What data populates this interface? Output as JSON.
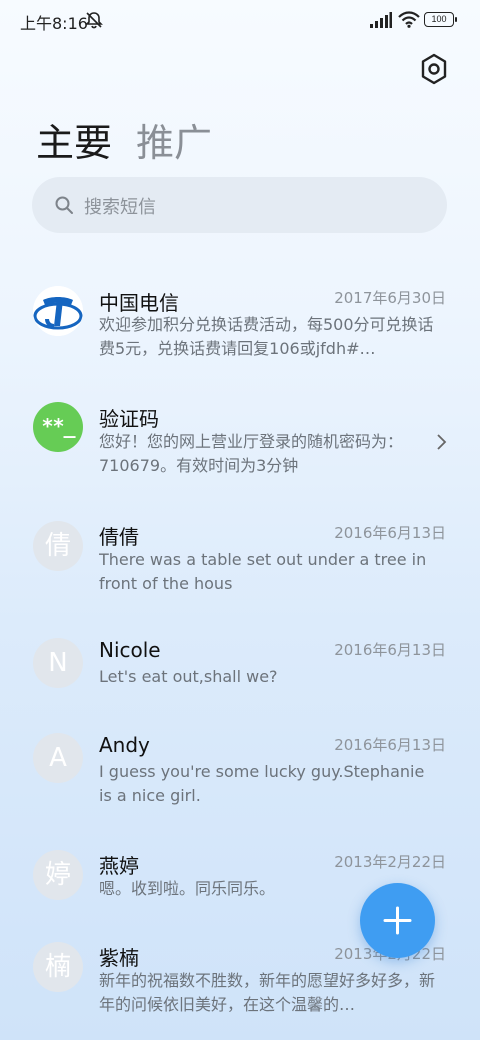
{
  "status": {
    "time": "上午8:16",
    "battery": "100"
  },
  "header": {
    "tabs": [
      {
        "label": "主要"
      },
      {
        "label": "推广"
      }
    ]
  },
  "search": {
    "placeholder": "搜索短信"
  },
  "conversations": [
    {
      "name": "中国电信",
      "date": "2017年6月30日",
      "preview": "欢迎参加积分兑换话费活动，每500分可兑换话费5元，兑换话费请回复106或jfdh#…",
      "avatar": "telecom-logo-icon"
    },
    {
      "name": "验证码",
      "date": "",
      "preview": "您好！您的网上营业厅登录的随机密码为：710679。有效时间为3分钟",
      "avatar_text": "**_"
    },
    {
      "name": "倩倩",
      "date": "2016年6月13日",
      "preview": "There was a table set out under a tree in front of the hous",
      "avatar_text": "倩"
    },
    {
      "name": "Nicole",
      "date": "2016年6月13日",
      "preview": "Let's eat out,shall we?",
      "avatar_text": "N"
    },
    {
      "name": "Andy",
      "date": "2016年6月13日",
      "preview": "I guess you're some lucky guy.Stephanie is a nice girl.",
      "avatar_text": "A"
    },
    {
      "name": "燕婷",
      "date": "2013年2月22日",
      "preview": "嗯。收到啦。同乐同乐。",
      "avatar_text": "婷"
    },
    {
      "name": "紫楠",
      "date": "2013年2月22日",
      "preview": "新年的祝福数不胜数，新年的愿望好多好多，新年的问候依旧美好，在这个温馨的…",
      "avatar_text": "楠"
    }
  ],
  "colors": {
    "accent": "#3f9df2",
    "code_avatar": "#66cc55",
    "telecom_blue": "#1565c0"
  }
}
